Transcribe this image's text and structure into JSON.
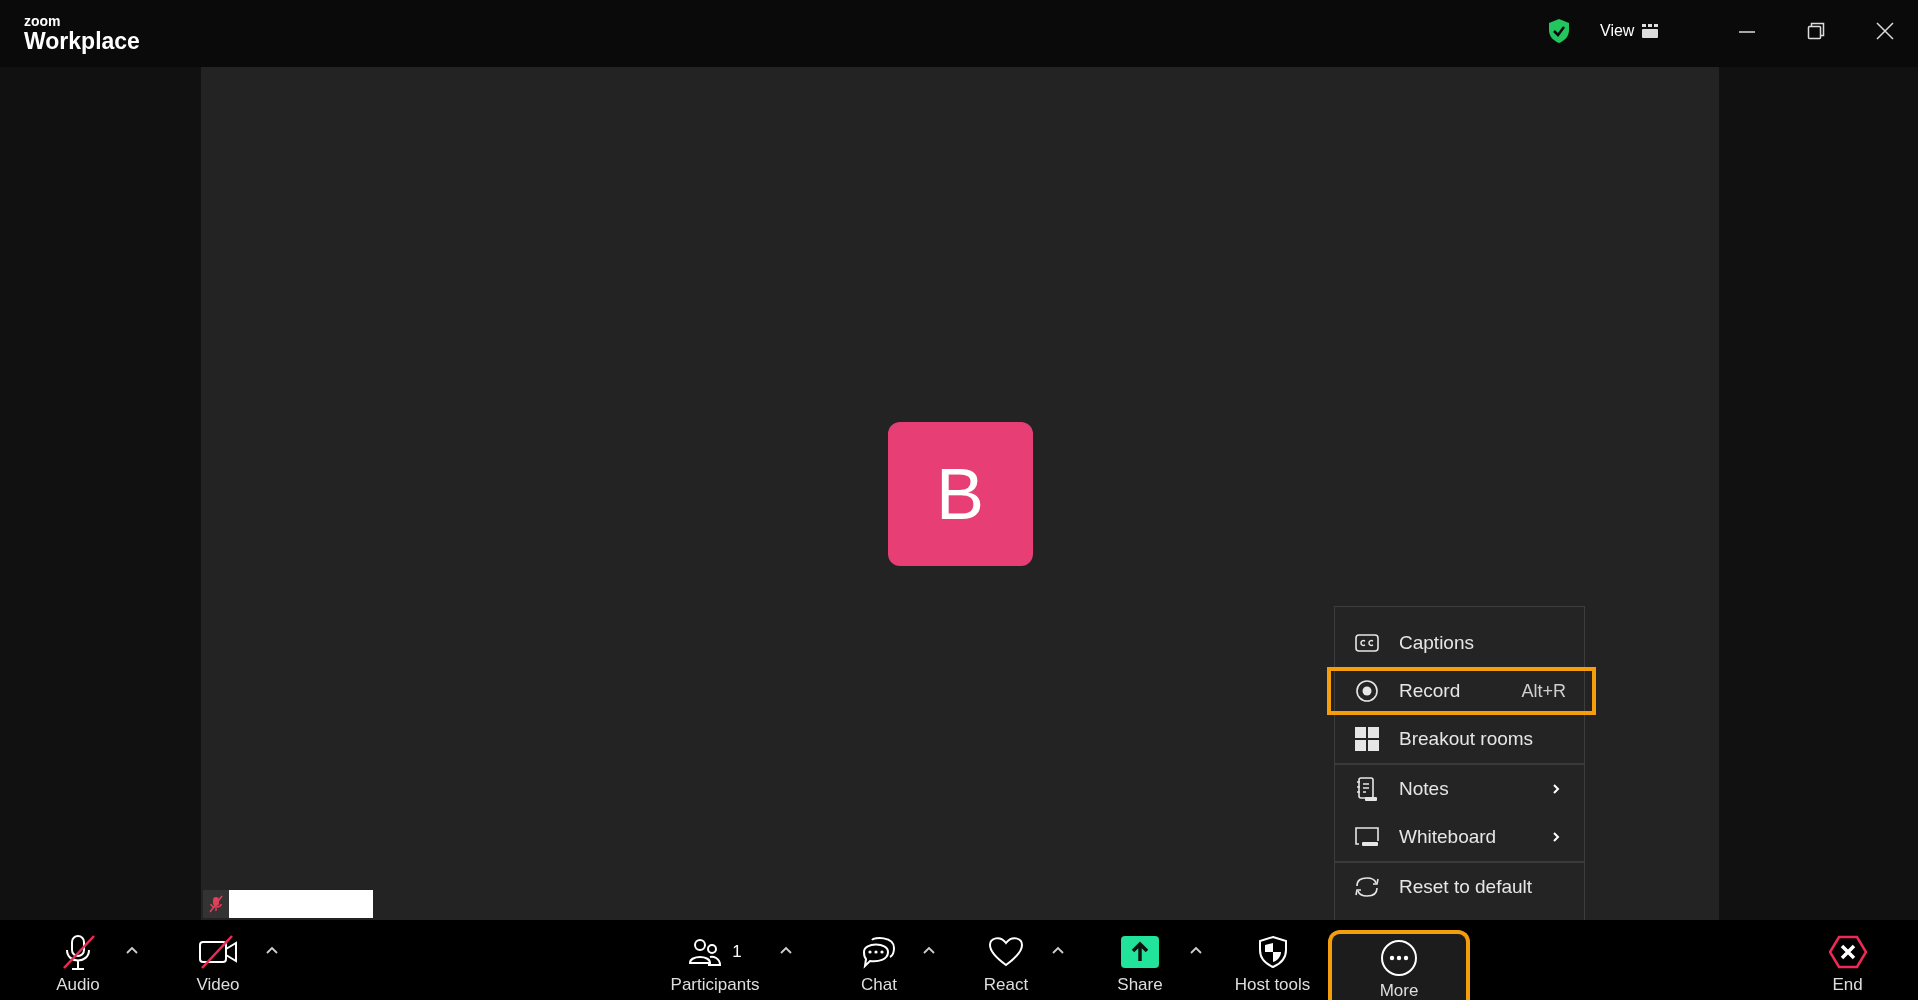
{
  "title_bar": {
    "logo_top": "zoom",
    "logo_bottom": "Workplace",
    "view_label": "View"
  },
  "stage": {
    "avatar_letter": "B",
    "name_tag": {
      "muted": true
    }
  },
  "more_menu": [
    {
      "kind": "captions",
      "label": "Captions",
      "highlighted": false,
      "submenu": false,
      "divider_after": false
    },
    {
      "kind": "record",
      "label": "Record",
      "shortcut": "Alt+R",
      "highlighted": true,
      "submenu": false,
      "divider_after": false
    },
    {
      "kind": "breakout",
      "label": "Breakout rooms",
      "highlighted": false,
      "submenu": false,
      "divider_after": true
    },
    {
      "kind": "notes",
      "label": "Notes",
      "highlighted": false,
      "submenu": true,
      "divider_after": false
    },
    {
      "kind": "whiteboard",
      "label": "Whiteboard",
      "highlighted": false,
      "submenu": true,
      "divider_after": true
    },
    {
      "kind": "reset",
      "label": "Reset to default",
      "highlighted": false,
      "submenu": false,
      "divider_after": false
    }
  ],
  "toolbar": [
    {
      "kind": "audio",
      "label": "Audio",
      "muted": true,
      "caret": true,
      "highlighted": false
    },
    {
      "kind": "video",
      "label": "Video",
      "muted": true,
      "caret": true,
      "highlighted": false
    },
    {
      "kind": "participants",
      "label": "Participants",
      "count": "1",
      "caret": true,
      "highlighted": false
    },
    {
      "kind": "chat",
      "label": "Chat",
      "caret": true,
      "highlighted": false
    },
    {
      "kind": "react",
      "label": "React",
      "caret": true,
      "highlighted": false
    },
    {
      "kind": "share",
      "label": "Share",
      "caret": true,
      "highlighted": false
    },
    {
      "kind": "hosttools",
      "label": "Host tools",
      "caret": false,
      "highlighted": false
    },
    {
      "kind": "more",
      "label": "More",
      "caret": false,
      "highlighted": true
    },
    {
      "kind": "end",
      "label": "End",
      "caret": false,
      "highlighted": false
    }
  ]
}
